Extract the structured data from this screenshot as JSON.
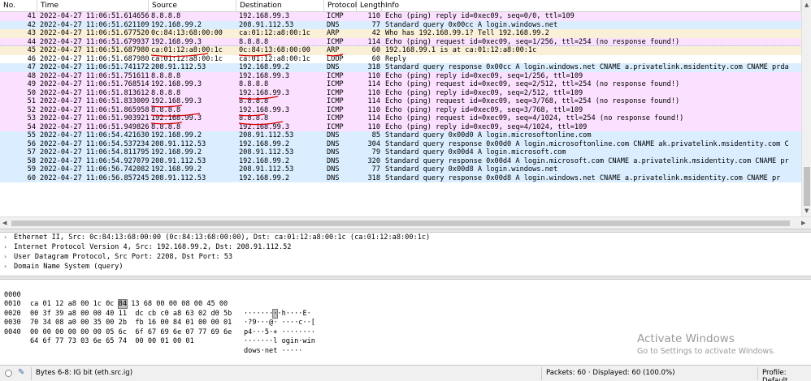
{
  "colors": {
    "icmp": "#fce0ff",
    "udp": "#daeeff",
    "arp": "#faf0d7",
    "loop": "#ffffff",
    "selected_ring": "#9fb7d8",
    "annotation": "#d40000"
  },
  "packet_list": {
    "columns": [
      "No.",
      "Time",
      "Source",
      "Destination",
      "Protocol",
      "Length",
      "Info"
    ],
    "rows": [
      {
        "no": "41",
        "time": "2022-04-27 11:06:51.614656",
        "src": "8.8.8.8",
        "dst": "192.168.99.3",
        "proto": "ICMP",
        "len": "110",
        "info": "Echo (ping) reply    id=0xec09, seq=0/0, ttl=109",
        "kind": "icmp"
      },
      {
        "no": "42",
        "time": "2022-04-27 11:06:51.621109",
        "src": "192.168.99.2",
        "dst": "208.91.112.53",
        "proto": "DNS",
        "len": "77",
        "info": "Standard query 0x00cc A login.windows.net",
        "kind": "udp"
      },
      {
        "no": "43",
        "time": "2022-04-27 11:06:51.677520",
        "src": "0c:84:13:68:00:00",
        "dst": "ca:01:12:a8:00:1c",
        "proto": "ARP",
        "len": "42",
        "info": "Who has 192.168.99.1? Tell 192.168.99.2",
        "kind": "arp"
      },
      {
        "no": "44",
        "time": "2022-04-27 11:06:51.679937",
        "src": "192.168.99.3",
        "dst": "8.8.8.8",
        "proto": "ICMP",
        "len": "114",
        "info": "Echo (ping) request  id=0xec09, seq=1/256, ttl=254 (no response found!)",
        "kind": "icmp"
      },
      {
        "no": "45",
        "time": "2022-04-27 11:06:51.687980",
        "src": "ca:01:12:a8:00:1c",
        "dst": "0c:84:13:68:00:00",
        "proto": "ARP",
        "len": "60",
        "info": "192.168.99.1 is at ca:01:12:a8:00:1c",
        "kind": "arp",
        "selected": true
      },
      {
        "no": "46",
        "time": "2022-04-27 11:06:51.687980",
        "src": "ca:01:12:a8:00:1c",
        "dst": "ca:01:12:a8:00:1c",
        "proto": "LOOP",
        "len": "60",
        "info": "Reply",
        "kind": "loop"
      },
      {
        "no": "47",
        "time": "2022-04-27 11:06:51.741172",
        "src": "208.91.112.53",
        "dst": "192.168.99.2",
        "proto": "DNS",
        "len": "318",
        "info": "Standard query response 0x00cc A login.windows.net CNAME a.privatelink.msidentity.com CNAME prda",
        "kind": "udp"
      },
      {
        "no": "48",
        "time": "2022-04-27 11:06:51.751611",
        "src": "8.8.8.8",
        "dst": "192.168.99.3",
        "proto": "ICMP",
        "len": "110",
        "info": "Echo (ping) reply    id=0xec09, seq=1/256, ttl=109",
        "kind": "icmp"
      },
      {
        "no": "49",
        "time": "2022-04-27 11:06:51.768514",
        "src": "192.168.99.3",
        "dst": "8.8.8.8",
        "proto": "ICMP",
        "len": "114",
        "info": "Echo (ping) request  id=0xec09, seq=2/512, ttl=254 (no response found!)",
        "kind": "icmp"
      },
      {
        "no": "50",
        "time": "2022-04-27 11:06:51.813612",
        "src": "8.8.8.8",
        "dst": "192.168.99.3",
        "proto": "ICMP",
        "len": "110",
        "info": "Echo (ping) reply    id=0xec09, seq=2/512, ttl=109",
        "kind": "icmp"
      },
      {
        "no": "51",
        "time": "2022-04-27 11:06:51.833009",
        "src": "192.168.99.3",
        "dst": "8.8.8.8",
        "proto": "ICMP",
        "len": "114",
        "info": "Echo (ping) request  id=0xec09, seq=3/768, ttl=254 (no response found!)",
        "kind": "icmp"
      },
      {
        "no": "52",
        "time": "2022-04-27 11:06:51.865958",
        "src": "8.8.8.8",
        "dst": "192.168.99.3",
        "proto": "ICMP",
        "len": "110",
        "info": "Echo (ping) reply    id=0xec09, seq=3/768, ttl=109",
        "kind": "icmp"
      },
      {
        "no": "53",
        "time": "2022-04-27 11:06:51.903921",
        "src": "192.168.99.3",
        "dst": "8.8.8.8",
        "proto": "ICMP",
        "len": "114",
        "info": "Echo (ping) request  id=0xec09, seq=4/1024, ttl=254 (no response found!)",
        "kind": "icmp"
      },
      {
        "no": "54",
        "time": "2022-04-27 11:06:51.949826",
        "src": "8.8.8.8",
        "dst": "192.168.99.3",
        "proto": "ICMP",
        "len": "110",
        "info": "Echo (ping) reply    id=0xec09, seq=4/1024, ttl=109",
        "kind": "icmp"
      },
      {
        "no": "55",
        "time": "2022-04-27 11:06:54.421630",
        "src": "192.168.99.2",
        "dst": "208.91.112.53",
        "proto": "DNS",
        "len": "85",
        "info": "Standard query 0x00d0 A login.microsoftonline.com",
        "kind": "udp"
      },
      {
        "no": "56",
        "time": "2022-04-27 11:06:54.537234",
        "src": "208.91.112.53",
        "dst": "192.168.99.2",
        "proto": "DNS",
        "len": "304",
        "info": "Standard query response 0x00d0 A login.microsoftonline.com CNAME ak.privatelink.msidentity.com C",
        "kind": "udp"
      },
      {
        "no": "57",
        "time": "2022-04-27 11:06:54.811795",
        "src": "192.168.99.2",
        "dst": "208.91.112.53",
        "proto": "DNS",
        "len": "79",
        "info": "Standard query 0x00d4 A login.microsoft.com",
        "kind": "udp"
      },
      {
        "no": "58",
        "time": "2022-04-27 11:06:54.927079",
        "src": "208.91.112.53",
        "dst": "192.168.99.2",
        "proto": "DNS",
        "len": "320",
        "info": "Standard query response 0x00d4 A login.microsoft.com CNAME a.privatelink.msidentity.com CNAME pr",
        "kind": "udp"
      },
      {
        "no": "59",
        "time": "2022-04-27 11:06:56.742082",
        "src": "192.168.99.2",
        "dst": "208.91.112.53",
        "proto": "DNS",
        "len": "77",
        "info": "Standard query 0x00d8 A login.windows.net",
        "kind": "udp"
      },
      {
        "no": "60",
        "time": "2022-04-27 11:06:56.857245",
        "src": "208.91.112.53",
        "dst": "192.168.99.2",
        "proto": "DNS",
        "len": "318",
        "info": "Standard query response 0x00d8 A login.windows.net CNAME a.privatelink.msidentity.com CNAME pr",
        "kind": "udp"
      }
    ]
  },
  "details": {
    "rows": [
      "Ethernet II, Src: 0c:84:13:68:00:00 (0c:84:13:68:00:00), Dst: ca:01:12:a8:00:1c (ca:01:12:a8:00:1c)",
      "Internet Protocol Version 4, Src: 192.168.99.2, Dst: 208.91.112.52",
      "User Datagram Protocol, Src Port: 2208, Dst Port: 53",
      "Domain Name System (query)"
    ]
  },
  "bytes": {
    "rows": [
      {
        "offset": "0000",
        "hex_a": "ca 01 12 a8 00 1c 0c ",
        "hex_hl": "84",
        "hex_b": " 13 68 00 00 08 00 45 00",
        "ascii_a": "·······",
        "ascii_hl": "·",
        "ascii_b": "·h····E·"
      },
      {
        "offset": "0010",
        "hex": "00 3f 39 a8 00 00 40 11  dc cb c0 a8 63 02 d0 5b",
        "ascii": "·?9···@· ····c··["
      },
      {
        "offset": "0020",
        "hex": "70 34 08 a0 00 35 00 2b  fb 16 00 84 01 00 00 01",
        "ascii": "p4···5·+ ········"
      },
      {
        "offset": "0030",
        "hex": "00 00 00 00 00 00 05 6c  6f 67 69 6e 07 77 69 6e",
        "ascii": "·······l ogin·win"
      },
      {
        "offset": "0040",
        "hex": "64 6f 77 73 03 6e 65 74  00 00 01 00 01",
        "ascii": "dows·net ·····"
      }
    ]
  },
  "watermark": {
    "title": "Activate Windows",
    "subtitle": "Go to Settings to activate Windows."
  },
  "status": {
    "field": "Bytes 6-8: IG bit (eth.src.ig)",
    "packets": "Packets: 60 · Displayed: 60 (100.0%)",
    "profile": "Profile: Default"
  },
  "icons": {
    "expert": "expert-info-indicator-icon",
    "edit": "edit-comment-icon",
    "expand": "tree-expand-arrow-icon",
    "scroll_up": "scroll-up-icon",
    "scroll_down": "scroll-down-icon",
    "scroll_left": "scroll-left-icon",
    "scroll_right": "scroll-right-icon"
  }
}
